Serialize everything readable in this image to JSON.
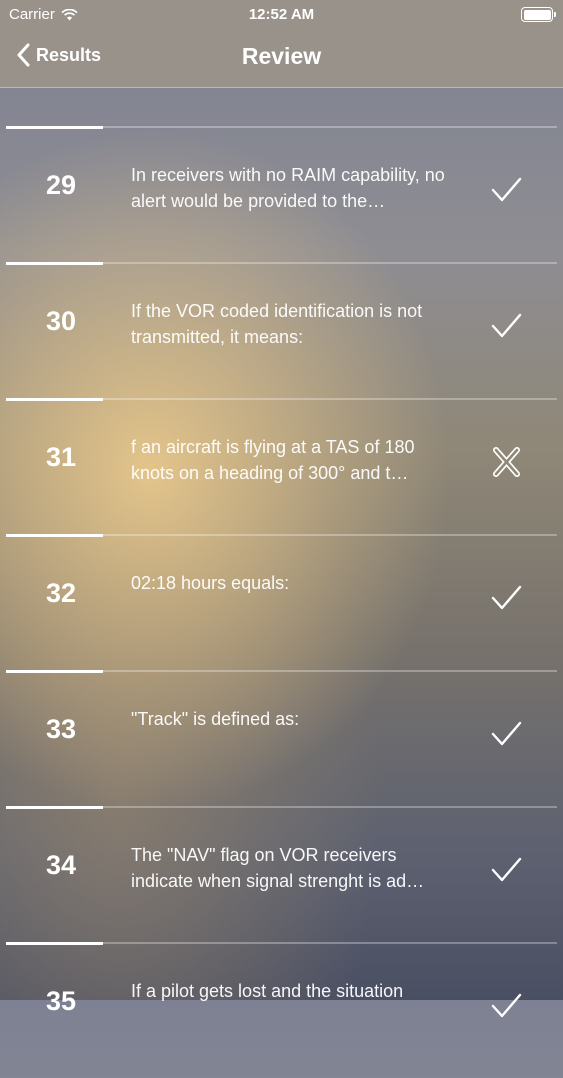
{
  "status_bar": {
    "carrier": "Carrier",
    "time": "12:52 AM",
    "icons": [
      "wifi-icon",
      "battery-icon"
    ]
  },
  "nav": {
    "back_label": "Results",
    "title": "Review"
  },
  "questions": [
    {
      "number": "29",
      "text": "In receivers with no RAIM capability, no alert would be provided to the…",
      "result": "correct"
    },
    {
      "number": "30",
      "text": "If the VOR coded identification is not transmitted, it means:",
      "result": "correct"
    },
    {
      "number": "31",
      "text": "f an aircraft is flying at a TAS of 180 knots  on a heading of 300° and t…",
      "result": "incorrect"
    },
    {
      "number": "32",
      "text": "02:18 hours equals:",
      "result": "correct"
    },
    {
      "number": "33",
      "text": "\"Track\" is defined as:",
      "result": "correct"
    },
    {
      "number": "34",
      "text": "The \"NAV\" flag on VOR receivers indicate when signal strenght is ad…",
      "result": "correct"
    },
    {
      "number": "35",
      "text": "If a pilot gets lost and the situation",
      "result": "correct"
    }
  ]
}
